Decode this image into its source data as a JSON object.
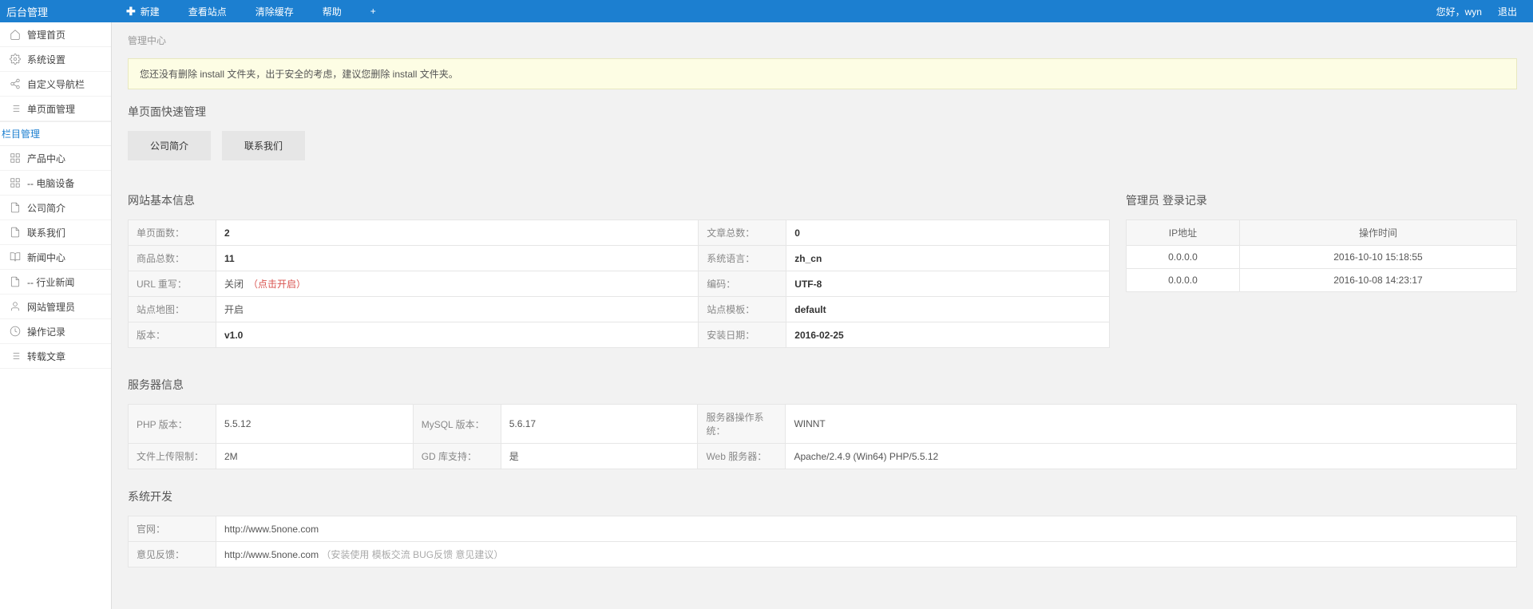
{
  "header": {
    "logo": "后台管理",
    "nav": {
      "new": "新建",
      "view_site": "查看站点",
      "clear_cache": "清除缓存",
      "help": "帮助",
      "plus": "+"
    },
    "greeting": "您好，wyn",
    "logout": "退出"
  },
  "sidebar": {
    "home": "管理首页",
    "settings": "系统设置",
    "custom_nav": "自定义导航栏",
    "single_page": "单页面管理",
    "group_columns": "栏目管理",
    "product_center": "产品中心",
    "computer_equip": "-- 电脑设备",
    "company_intro": "公司简介",
    "contact_us": "联系我们",
    "news_center": "新闻中心",
    "industry_news": "-- 行业新闻",
    "site_admin": "网站管理员",
    "op_log": "操作记录",
    "repost": "转载文章"
  },
  "main": {
    "breadcrumb": "管理中心",
    "alert": "您还没有删除 install 文件夹，出于安全的考虑，建议您删除 install 文件夹。",
    "quick_title": "单页面快速管理",
    "tabs": {
      "intro": "公司简介",
      "contact": "联系我们"
    },
    "site_info_title": "网站基本信息",
    "admin_log_title": "管理员 登录记录",
    "site_info": {
      "pages_label": "单页面数：",
      "pages_value": "2",
      "articles_label": "文章总数：",
      "articles_value": "0",
      "goods_label": "商品总数：",
      "goods_value": "11",
      "lang_label": "系统语言：",
      "lang_value": "zh_cn",
      "url_label": "URL 重写：",
      "url_value": "关闭",
      "url_link": "（点击开启）",
      "encoding_label": "编码：",
      "encoding_value": "UTF-8",
      "sitemap_label": "站点地图：",
      "sitemap_value": "开启",
      "template_label": "站点模板：",
      "template_value": "default",
      "version_label": "版本：",
      "version_value": "v1.0",
      "install_label": "安装日期：",
      "install_value": "2016-02-25"
    },
    "log_headers": {
      "ip": "IP地址",
      "time": "操作时间"
    },
    "log_rows": [
      {
        "ip": "0.0.0.0",
        "time": "2016-10-10 15:18:55"
      },
      {
        "ip": "0.0.0.0",
        "time": "2016-10-08 14:23:17"
      }
    ],
    "server_title": "服务器信息",
    "server": {
      "php_label": "PHP 版本：",
      "php_value": "5.5.12",
      "mysql_label": "MySQL 版本：",
      "mysql_value": "5.6.17",
      "os_label": "服务器操作系统：",
      "os_value": "WINNT",
      "upload_label": "文件上传限制：",
      "upload_value": "2M",
      "gd_label": "GD 库支持：",
      "gd_value": "是",
      "web_label": "Web 服务器：",
      "web_value": "Apache/2.4.9 (Win64) PHP/5.5.12"
    },
    "dev_title": "系统开发",
    "dev": {
      "site_label": "官网：",
      "site_value": "http://www.5none.com",
      "feedback_label": "意见反馈：",
      "feedback_value": "http://www.5none.com",
      "feedback_note": "（安装使用 模板交流 BUG反馈 意见建议）"
    }
  }
}
